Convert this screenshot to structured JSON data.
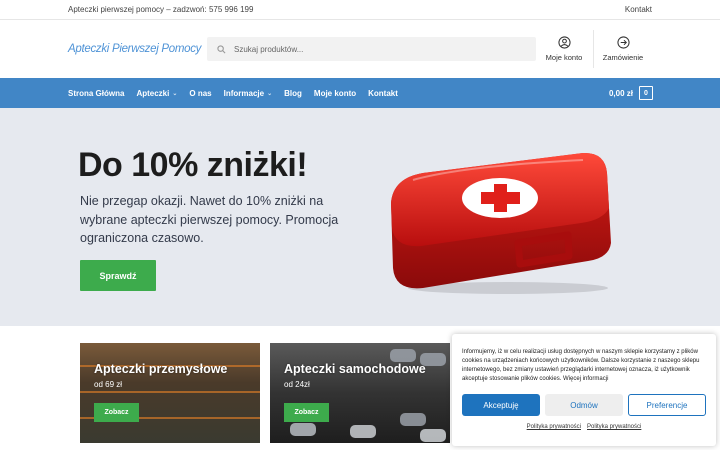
{
  "topbar": {
    "info": "Apteczki pierwszej pomocy – zadzwoń: 575 996 199",
    "contact": "Kontakt"
  },
  "header": {
    "logo": "Apteczki Pierwszej Pomocy",
    "search_placeholder": "Szukaj produktów...",
    "account_label": "Moje konto",
    "checkout_label": "Zamówienie",
    "icons": [
      "search-icon",
      "user-icon",
      "arrow-circle-icon"
    ]
  },
  "nav": {
    "items": [
      {
        "label": "Strona Główna"
      },
      {
        "label": "Apteczki"
      },
      {
        "label": "O nas"
      },
      {
        "label": "Informacje"
      },
      {
        "label": "Blog"
      },
      {
        "label": "Moje konto"
      },
      {
        "label": "Kontakt"
      }
    ],
    "cart_total": "0,00 zł",
    "cart_count": "0"
  },
  "hero": {
    "title": "Do 10% zniżki!",
    "text": "Nie przegap okazji. Nawet do 10% zniżki na wybrane apteczki pierwszej pomocy. Promocja ograniczona czasowo.",
    "button": "Sprawdź"
  },
  "cards": [
    {
      "title": "Apteczki przemysłowe",
      "price": "od 69 zł",
      "button": "Zobacz"
    },
    {
      "title": "Apteczki samochodowe",
      "price": "od 24zł",
      "button": "Zobacz"
    }
  ],
  "cookie": {
    "text": "Informujemy, iż w celu realizacji usług dostępnych w naszym sklepie korzystamy z plików cookies na urządzeniach końcowych użytkowników. Dalsze korzystanie z naszego sklepu internetowego, bez zmiany ustawień przeglądarki internetowej oznacza, iż użytkownik akceptuje stosowanie plików cookies. Więcej informacji",
    "accept": "Akceptuję",
    "deny": "Odmów",
    "preferences": "Preferencje",
    "link1": "Polityka prywatności",
    "link2": "Polityka prywatności"
  },
  "colors": {
    "nav": "#4186c6",
    "cta": "#3dab4c",
    "hero_bg": "#e6e9ef",
    "cookie_primary": "#1e73be"
  }
}
